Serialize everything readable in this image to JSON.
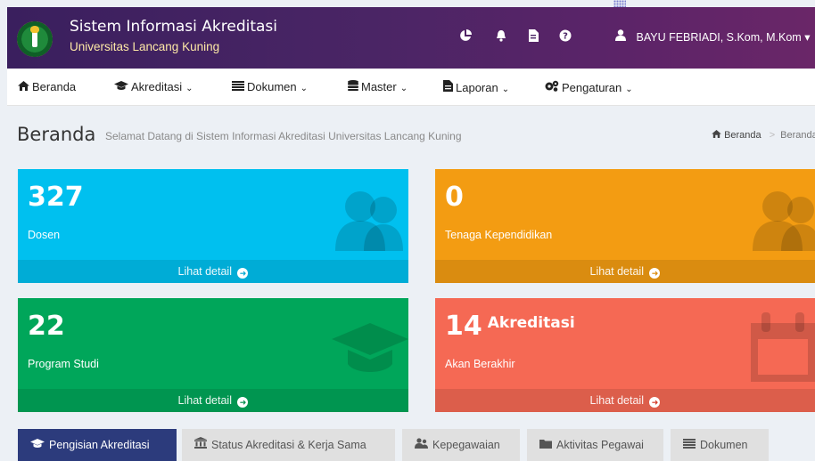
{
  "header": {
    "app_title": "Sistem Informasi Akreditasi",
    "app_subtitle": "Universitas Lancang Kuning",
    "icons": [
      "pie-chart-icon",
      "bell-icon",
      "file-icon",
      "help-icon"
    ],
    "user_name": "BAYU FEBRIADI, S.Kom, M.Kom",
    "user_caret": "▾"
  },
  "nav": {
    "items": [
      {
        "label": "Beranda",
        "icon": "home-icon"
      },
      {
        "label": "Akreditasi",
        "icon": "graduation-cap-icon",
        "caret": "⌄"
      },
      {
        "label": "Dokumen",
        "icon": "list-icon",
        "caret": "⌄"
      },
      {
        "label": "Master",
        "icon": "database-icon",
        "caret": "⌄"
      },
      {
        "label": "Laporan",
        "icon": "report-icon",
        "caret": "⌄"
      },
      {
        "label": "Pengaturan",
        "icon": "cogs-icon",
        "caret": "⌄"
      }
    ]
  },
  "content_header": {
    "title": "Beranda",
    "description": "Selamat Datang di Sistem Informasi Akreditasi Universitas Lancang Kuning",
    "breadcrumb_home": "Beranda",
    "breadcrumb_sep": ">",
    "breadcrumb_current": "Beranda"
  },
  "boxes": [
    {
      "number": "327",
      "extra": "",
      "label": "Dosen",
      "more": "Lihat detail",
      "color": "#00c0ef",
      "icon": "users-icon"
    },
    {
      "number": "0",
      "extra": "",
      "label": "Tenaga Kependidikan",
      "more": "Lihat detail",
      "color": "#f39c12",
      "icon": "users-icon"
    },
    {
      "number": "22",
      "extra": "",
      "label": "Program Studi",
      "more": "Lihat detail",
      "color": "#00a65a",
      "icon": "graduation-cap-icon"
    },
    {
      "number": "14",
      "extra": "Akreditasi",
      "label": "Akan Berakhir",
      "more": "Lihat detail",
      "color": "#f56954",
      "icon": "calendar-icon"
    }
  ],
  "tabs": [
    {
      "label": "Pengisian Akreditasi",
      "icon": "graduation-cap-icon",
      "active": true
    },
    {
      "label": "Status Akreditasi & Kerja Sama",
      "icon": "institution-icon",
      "active": false
    },
    {
      "label": "Kepegawaian",
      "icon": "users-icon",
      "active": false
    },
    {
      "label": "Aktivitas Pegawai",
      "icon": "folder-icon",
      "active": false
    },
    {
      "label": "Dokumen",
      "icon": "list-icon",
      "active": false
    }
  ]
}
